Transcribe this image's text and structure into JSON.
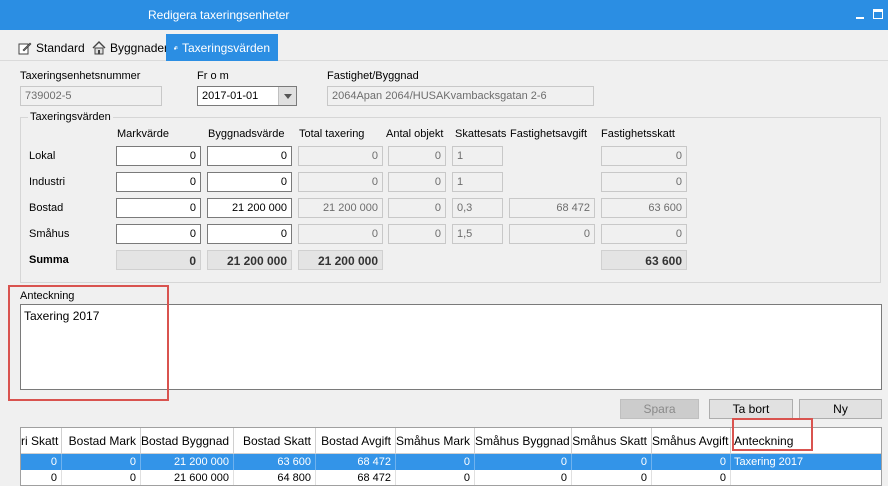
{
  "window": {
    "title": "Redigera taxeringsenheter"
  },
  "tabs": [
    {
      "label": "Standard",
      "icon": "edit-icon"
    },
    {
      "label": "Byggnader",
      "icon": "house-icon"
    },
    {
      "label": "Taxeringsvärden",
      "icon": "boxes-icon"
    }
  ],
  "header": {
    "unit_number_label": "Taxeringsenhetsnummer",
    "unit_number_value": "739002-5",
    "from_label": "Fr o m",
    "from_value": "2017-01-01",
    "property_label": "Fastighet/Byggnad",
    "property_value": "2064Apan 2064/HUSAKvambacksgatan 2-6"
  },
  "values_group": {
    "title": "Taxeringsvärden",
    "columns": [
      "Markvärde",
      "Byggnadsvärde",
      "Total taxering",
      "Antal objekt",
      "Skattesats",
      "Fastighetsavgift",
      "Fastighetsskatt"
    ],
    "rows": [
      {
        "label": "Lokal",
        "mark": "0",
        "bygg": "0",
        "total": "0",
        "antal": "0",
        "sats": "1",
        "avgift": "",
        "skatt": "0"
      },
      {
        "label": "Industri",
        "mark": "0",
        "bygg": "0",
        "total": "0",
        "antal": "0",
        "sats": "1",
        "avgift": "",
        "skatt": "0"
      },
      {
        "label": "Bostad",
        "mark": "0",
        "bygg": "21 200 000",
        "total": "21 200 000",
        "antal": "0",
        "sats": "0,3",
        "avgift": "68 472",
        "skatt": "63 600"
      },
      {
        "label": "Småhus",
        "mark": "0",
        "bygg": "0",
        "total": "0",
        "antal": "0",
        "sats": "1,5",
        "avgift": "0",
        "skatt": "0"
      }
    ],
    "summa": {
      "label": "Summa",
      "mark": "0",
      "bygg": "21 200 000",
      "total": "21 200 000",
      "skatt": "63 600"
    }
  },
  "note": {
    "label": "Anteckning",
    "value": "Taxering 2017"
  },
  "buttons": {
    "save": "Spara",
    "delete": "Ta bort",
    "new": "Ny"
  },
  "grid": {
    "headers": [
      "ri Skatt",
      "Bostad Mark",
      "Bostad Byggnad",
      "Bostad Skatt",
      "Bostad Avgift",
      "Småhus Mark",
      "Småhus Byggnad",
      "Småhus Skatt",
      "Småhus Avgift",
      "Anteckning"
    ],
    "rows": [
      [
        "0",
        "0",
        "21 200 000",
        "63 600",
        "68 472",
        "0",
        "0",
        "0",
        "0",
        "Taxering 2017"
      ],
      [
        "0",
        "0",
        "21 600 000",
        "64 800",
        "68 472",
        "0",
        "0",
        "0",
        "0",
        ""
      ]
    ]
  },
  "colors": {
    "accent": "#2b8ee3",
    "selection": "#3394e8",
    "highlight_box": "#d9534f"
  }
}
